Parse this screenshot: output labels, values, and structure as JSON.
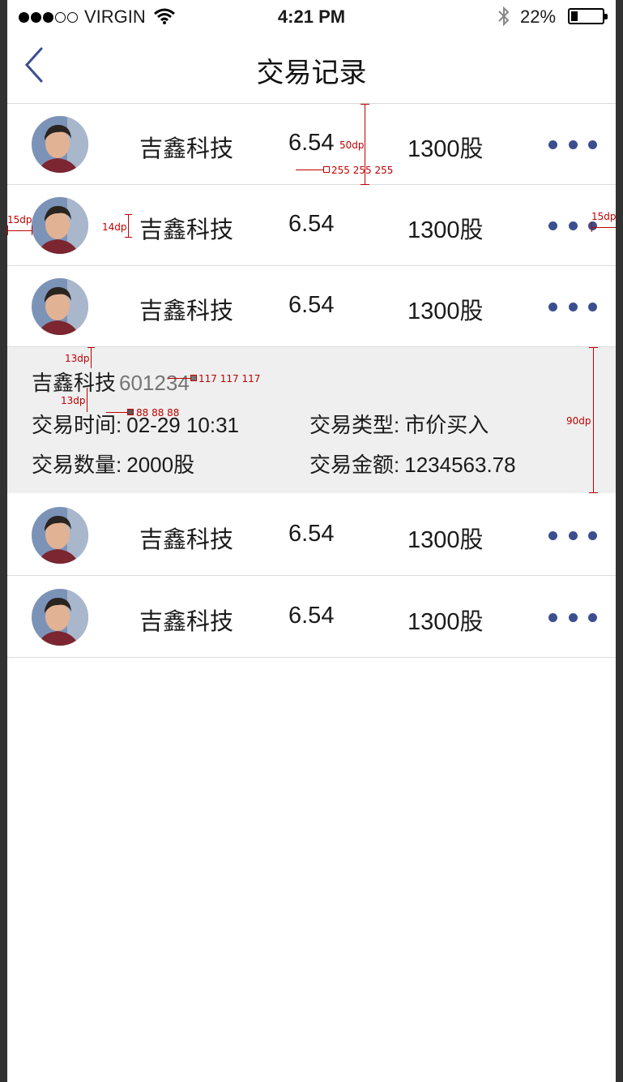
{
  "status_bar": {
    "carrier": "VIRGIN",
    "time": "4:21 PM",
    "battery_percent": "22%",
    "battery_level": 0.22
  },
  "nav": {
    "title": "交易记录",
    "back_icon": "chevron-left-icon"
  },
  "rows_top": [
    {
      "name": "吉鑫科技",
      "price": "6.54",
      "qty": "1300股"
    },
    {
      "name": "吉鑫科技",
      "price": "6.54",
      "qty": "1300股"
    },
    {
      "name": "吉鑫科技",
      "price": "6.54",
      "qty": "1300股"
    }
  ],
  "detail": {
    "name": "吉鑫科技",
    "code": "601234",
    "time_label": "交易时间:",
    "time_value": "02-29 10:31",
    "type_label": "交易类型:",
    "type_value": "市价买入",
    "qty_label": "交易数量:",
    "qty_value": "2000股",
    "amount_label": "交易金额:",
    "amount_value": "1234563.78"
  },
  "rows_bottom": [
    {
      "name": "吉鑫科技",
      "price": "6.54",
      "qty": "1300股"
    },
    {
      "name": "吉鑫科技",
      "price": "6.54",
      "qty": "1300股"
    }
  ],
  "annotations": {
    "row_height": "50dp",
    "row_bg": "255 255 255",
    "left_padding": "15dp",
    "avatar_gap": "14dp",
    "right_padding": "15dp",
    "detail_top": "13dp",
    "detail_gap": "13dp",
    "code_color": "117 117 117",
    "text_color": "88 88 88",
    "detail_height": "90dp"
  },
  "colors": {
    "accent": "#3b4f8f",
    "detail_bg": "#efefef",
    "code_text": "#757575",
    "annotation": "#c00000"
  }
}
